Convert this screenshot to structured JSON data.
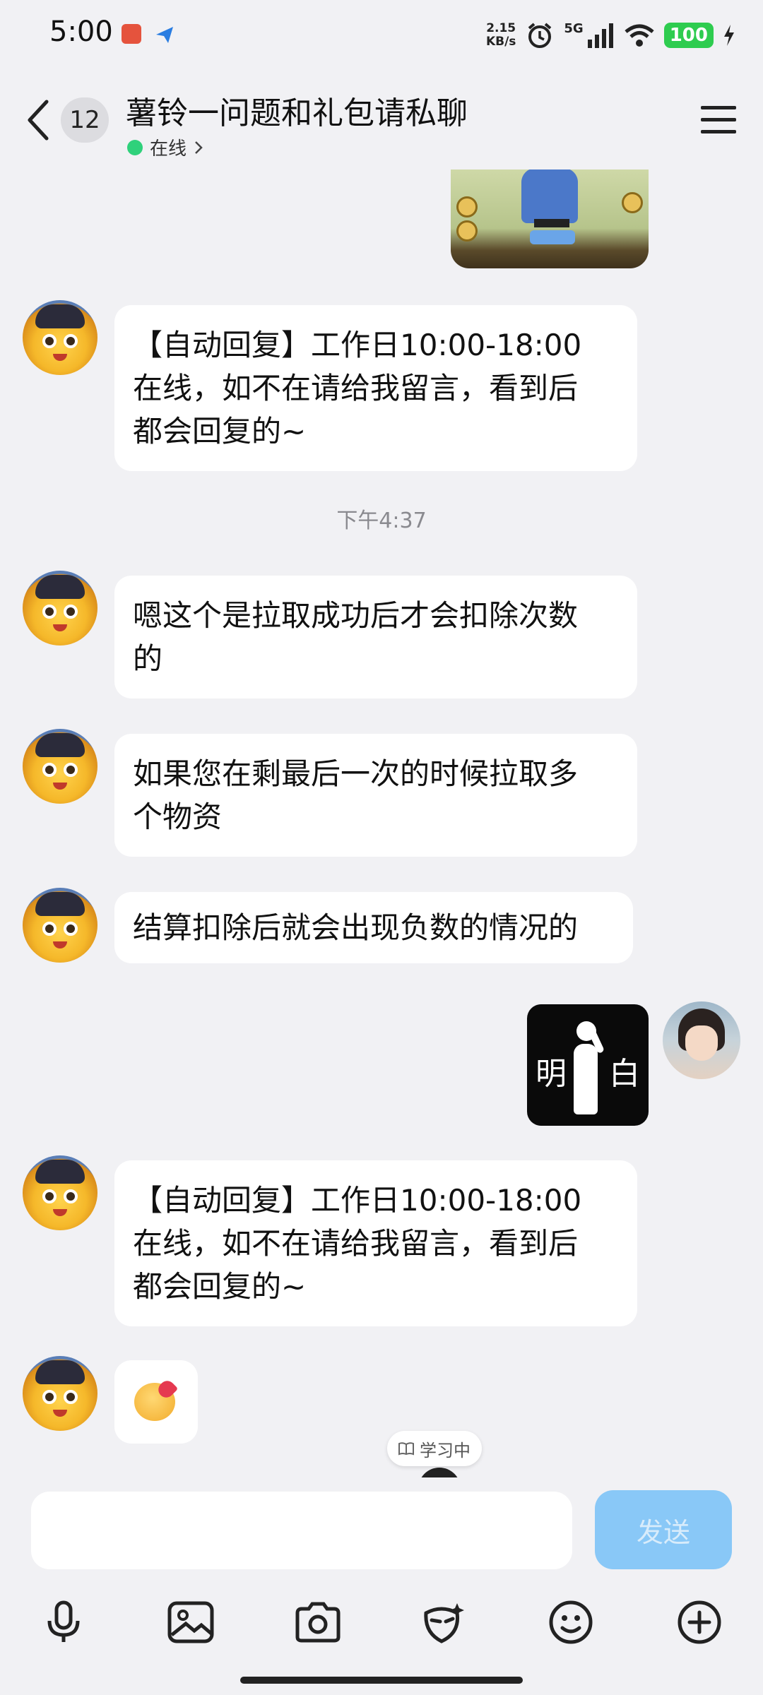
{
  "status_bar": {
    "time": "5:00",
    "net_speed_value": "2.15",
    "net_speed_unit": "KB/s",
    "network_type": "5G",
    "battery": "100"
  },
  "header": {
    "unread_count": "12",
    "title": "薯铃一问题和礼包请私聊",
    "online_status": "在线"
  },
  "messages": {
    "auto_reply_1": {
      "line1": "【自动回复】工作日10:00-18:00",
      "line2": "在线，如不在请给我留言，看到后",
      "line3": "都会回复的~"
    },
    "time_divider": "下午4:37",
    "msg_2": {
      "line1": "嗯这个是拉取成功后才会扣除次数",
      "line2": "的"
    },
    "msg_3": {
      "line1": "如果您在剩最后一次的时候拉取多",
      "line2": "个物资"
    },
    "msg_4": {
      "line1": "结算扣除后就会出现负数的情况的"
    },
    "sticker": {
      "left": "明",
      "right": "白"
    },
    "auto_reply_2": {
      "line1": "【自动回复】工作日10:00-18:00",
      "line2": "在线，如不在请给我留言，看到后",
      "line3": "都会回复的~"
    }
  },
  "study_pill": "学习中",
  "input": {
    "value": "",
    "send_label": "发送"
  },
  "toolbar": {
    "icons": [
      "microphone-icon",
      "image-icon",
      "camera-icon",
      "magic-face-icon",
      "emoji-icon",
      "plus-icon"
    ]
  },
  "colors": {
    "background": "#f1f1f4",
    "bubble": "#ffffff",
    "send_button": "#89c8f7",
    "online_dot": "#2fd17b",
    "battery": "#2ecc4f"
  }
}
